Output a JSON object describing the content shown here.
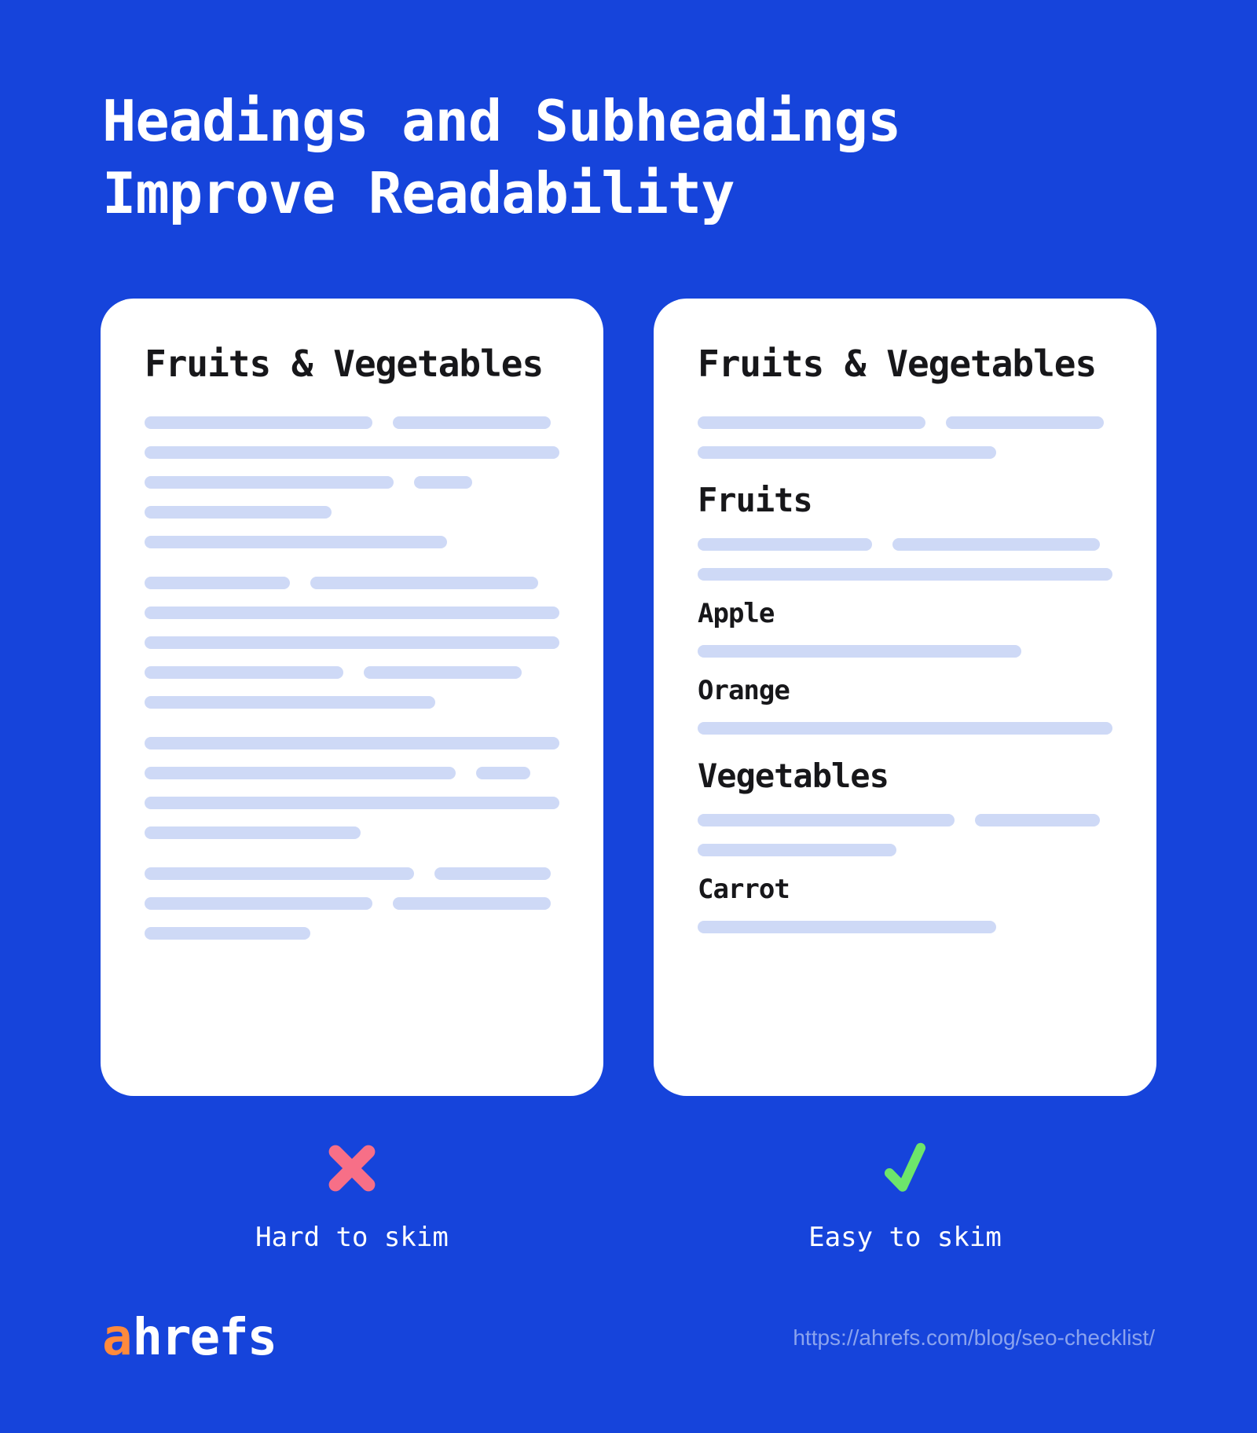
{
  "title_line1": "Headings and Subheadings",
  "title_line2": "Improve Readability",
  "left": {
    "card_title": "Fruits & Vegetables",
    "status_label": "Hard to skim"
  },
  "right": {
    "card_title": "Fruits & Vegetables",
    "h2_fruits": "Fruits",
    "h3_apple": "Apple",
    "h3_orange": "Orange",
    "h2_veg": "Vegetables",
    "h3_carrot": "Carrot",
    "status_label": "Easy to skim"
  },
  "footer": {
    "brand_a": "a",
    "brand_rest": "hrefs",
    "link": "https://ahrefs.com/blog/seo-checklist/"
  },
  "colors": {
    "bg": "#1644db",
    "skeleton": "#ced9f6",
    "cross": "#f76f87",
    "check": "#6de56b"
  }
}
